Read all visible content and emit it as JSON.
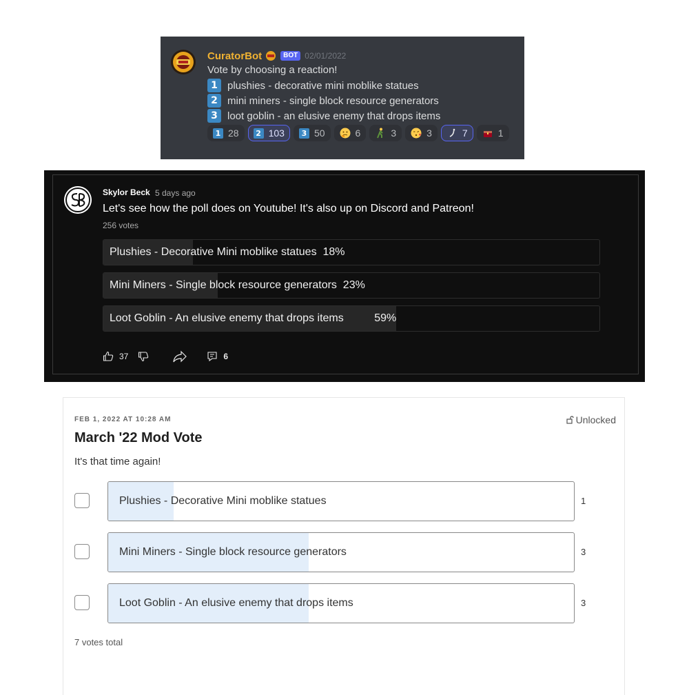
{
  "discord": {
    "author": "CuratorBot",
    "bot_tag": "BOT",
    "timestamp": "02/01/2022",
    "intro": "Vote by choosing a reaction!",
    "options": [
      {
        "key": "1",
        "text": "plushies - decorative mini moblike statues"
      },
      {
        "key": "2",
        "text": "mini miners - single block resource generators"
      },
      {
        "key": "3",
        "text": "loot goblin - an elusive enemy that drops items"
      }
    ],
    "reactions": [
      {
        "icon": "keycap-1",
        "key": "1",
        "count": "28",
        "active": false
      },
      {
        "icon": "keycap-2",
        "key": "2",
        "count": "103",
        "active": true
      },
      {
        "icon": "keycap-3",
        "key": "3",
        "count": "50",
        "active": false
      },
      {
        "icon": "thinking-face-icon",
        "count": "6",
        "active": false
      },
      {
        "icon": "person-walking-icon",
        "count": "3",
        "active": false
      },
      {
        "icon": "face-blowing-kiss-icon",
        "count": "3",
        "active": false
      },
      {
        "icon": "custom-emoji-icon",
        "count": "7",
        "active": true
      },
      {
        "icon": "treasure-chest-icon",
        "count": "1",
        "active": false
      }
    ],
    "colors": {
      "bg": "#36393f",
      "author": "#f0b232",
      "accent": "#5865f2",
      "keycap": "#3b88c3"
    }
  },
  "youtube": {
    "author": "Skylor Beck",
    "time": "5 days ago",
    "text": "Let's see how the poll does on Youtube! It's also up on Discord and Patreon!",
    "votes": "256 votes",
    "options": [
      {
        "label": "Plushies - Decorative Mini moblike statues  18%",
        "fraction": 0.18
      },
      {
        "label": "Mini Miners - Single block resource generators  23%",
        "fraction": 0.23
      },
      {
        "label": "Loot Goblin - An elusive enemy that drops items          59%",
        "fraction": 0.59
      }
    ],
    "likes": "37",
    "replies": "6"
  },
  "patreon": {
    "date": "FEB 1, 2022 AT 10:28 AM",
    "lock": "Unlocked",
    "title": "March '22 Mod Vote",
    "body": "It's that time again!",
    "options": [
      {
        "label": "Plushies - Decorative Mini moblike statues",
        "count": "1",
        "fraction": 0.14
      },
      {
        "label": "Mini Miners - Single block resource generators",
        "count": "3",
        "fraction": 0.43
      },
      {
        "label": "Loot Goblin - An elusive enemy that drops items",
        "count": "3",
        "fraction": 0.43
      }
    ],
    "total": "7 votes total"
  }
}
